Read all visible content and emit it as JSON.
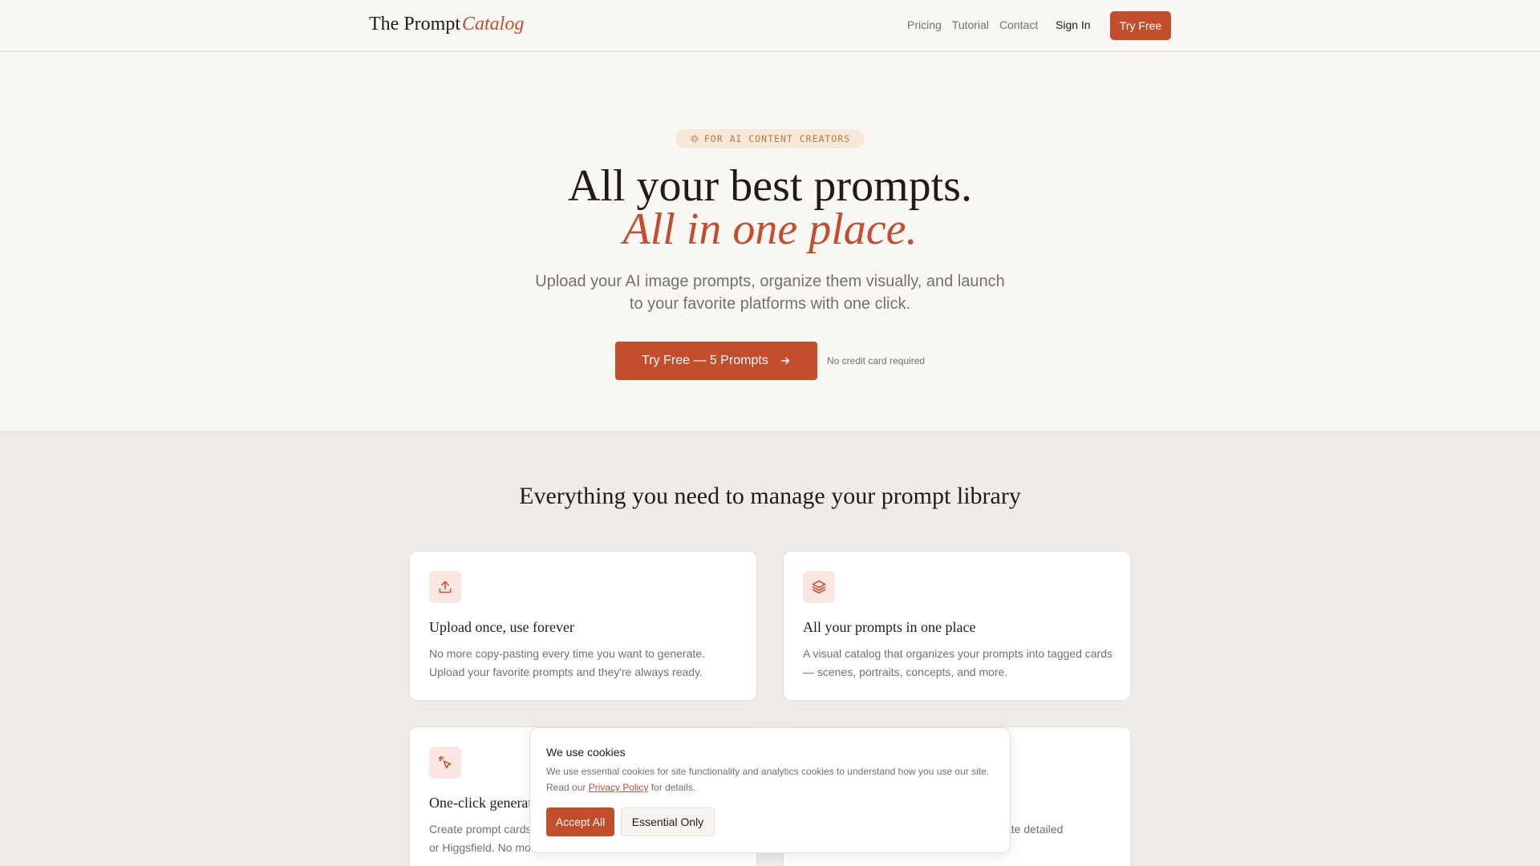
{
  "header": {
    "logo_main": "The Prompt",
    "logo_accent": "Catalog",
    "nav": [
      {
        "label": "Pricing"
      },
      {
        "label": "Tutorial"
      },
      {
        "label": "Contact"
      }
    ],
    "signin_label": "Sign In",
    "tryfree_label": "Try Free"
  },
  "hero": {
    "badge": "FOR AI CONTENT CREATORS",
    "title_line1": "All your best prompts.",
    "title_line2": "All in one place.",
    "subtitle": "Upload your AI image prompts, organize them visually, and launch to your favorite platforms with one click.",
    "cta_label": "Try Free — 5 Prompts",
    "cta_note": "No credit card required"
  },
  "features": {
    "title": "Everything you need to manage your prompt library",
    "cards": [
      {
        "icon": "upload-icon",
        "title": "Upload once, use forever",
        "description": "No more copy-pasting every time you want to generate. Upload your favorite prompts and they're always ready."
      },
      {
        "icon": "layers-icon",
        "title": "All your prompts in one place",
        "description": "A visual catalog that organizes your prompts into tagged cards — scenes, portraits, concepts, and more."
      },
      {
        "icon": "cursor-click-icon",
        "title": "One-click generat",
        "description": "Create prompt cards or Higgsfield. No mo"
      },
      {
        "icon": "",
        "title": "",
        "description": "ate detailed"
      }
    ]
  },
  "cookie": {
    "title": "We use cookies",
    "text_before": "We use essential cookies for site functionality and analytics cookies to understand how you use our site. Read our ",
    "link": "Privacy Policy",
    "text_after": " for details.",
    "accept_label": "Accept All",
    "essential_label": "Essential Only"
  },
  "colors": {
    "accent": "#c24e2e",
    "background": "#efebe6",
    "hero_background": "#f9f7f4",
    "muted_text": "#7a6e66"
  }
}
